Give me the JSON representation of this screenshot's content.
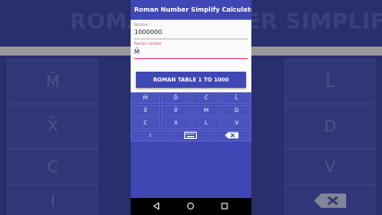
{
  "app": {
    "title": "Roman Number Simplify Calculator"
  },
  "number_field": {
    "label": "Number",
    "value": "1000000"
  },
  "roman_field": {
    "label": "Roman number",
    "value": "M̄"
  },
  "table_button": {
    "label": "ROMAN TABLE 1 TO 1000"
  },
  "keypad": {
    "row1": [
      "M̄",
      "D̄",
      "C̄",
      "L̄"
    ],
    "row2": [
      "X̄",
      "V̄",
      "M",
      "D"
    ],
    "row3": [
      "C",
      "X",
      "L",
      "V"
    ],
    "row4": [
      "I",
      "keyboard",
      "backspace"
    ]
  },
  "background": {
    "title": "ROMAN NUMBER SIMPLIFY CALCULATOR",
    "left_keys": [
      "M̄",
      "X̄",
      "C",
      "I"
    ],
    "right_keys": [
      "L̄",
      "D",
      "V"
    ]
  }
}
